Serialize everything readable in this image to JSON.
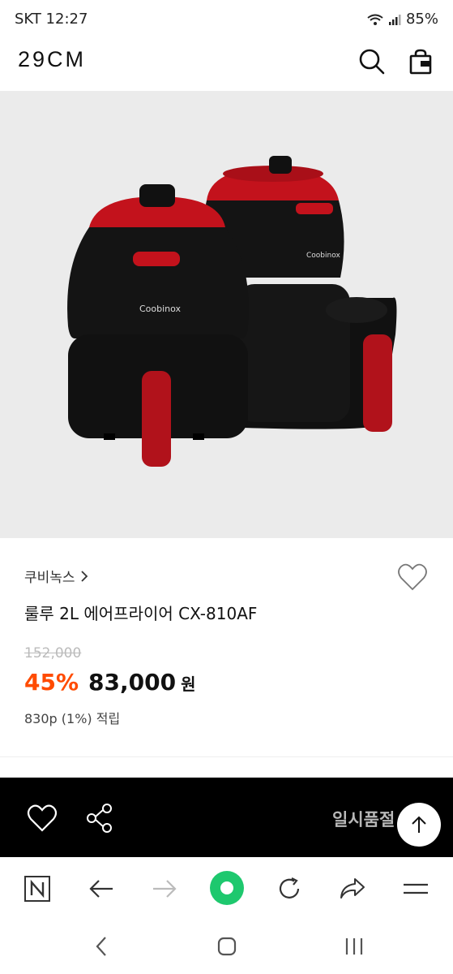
{
  "status_bar": {
    "carrier_time": "SKT 12:27",
    "battery": "85%"
  },
  "header": {
    "logo": "29CM"
  },
  "product": {
    "image_alt": "Coobinox air fryer",
    "brand_logo_text": "Coobinox",
    "brand": "쿠비녹스",
    "title": "룰루 2L 에어프라이어 CX-810AF",
    "original_price": "152,000",
    "discount": "45%",
    "sale_price": "83,000",
    "currency": "원",
    "points": "830p (1%) 적립"
  },
  "action_bar": {
    "status_label": "일시품절"
  },
  "colors": {
    "accent": "#ff4b00",
    "action_bar_bg": "#000000",
    "browser_home_green": "#1ec86e"
  }
}
